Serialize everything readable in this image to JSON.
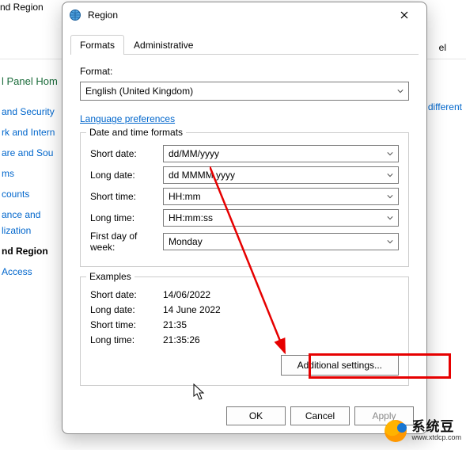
{
  "background": {
    "title_fragment": "nd Region",
    "right_link_fragment": "different",
    "right_text_fragment": "el",
    "home_fragment": "l Panel Hom",
    "sidebar": [
      " and Security",
      "rk and Intern",
      "are and Sou",
      "ms",
      "counts",
      "ance and",
      "lization",
      "nd Region",
      " Access"
    ]
  },
  "dialog": {
    "title": "Region",
    "tabs": {
      "formats": "Formats",
      "admin": "Administrative"
    },
    "format_label": "Format:",
    "format_value": "English (United Kingdom)",
    "lang_pref": "Language preferences",
    "group_dt_title": "Date and time formats",
    "fields": {
      "short_date": {
        "label": "Short date:",
        "value": "dd/MM/yyyy"
      },
      "long_date": {
        "label": "Long date:",
        "value": "dd MMMM yyyy"
      },
      "short_time": {
        "label": "Short time:",
        "value": "HH:mm"
      },
      "long_time": {
        "label": "Long time:",
        "value": "HH:mm:ss"
      },
      "first_dow": {
        "label": "First day of week:",
        "value": "Monday"
      }
    },
    "group_ex_title": "Examples",
    "examples": {
      "short_date": {
        "label": "Short date:",
        "value": "14/06/2022"
      },
      "long_date": {
        "label": "Long date:",
        "value": "14 June 2022"
      },
      "short_time": {
        "label": "Short time:",
        "value": "21:35"
      },
      "long_time": {
        "label": "Long time:",
        "value": "21:35:26"
      }
    },
    "additional_settings": "Additional settings...",
    "buttons": {
      "ok": "OK",
      "cancel": "Cancel",
      "apply": "Apply"
    }
  },
  "watermark": {
    "name": "系统豆",
    "url": "www.xtdcp.com"
  }
}
